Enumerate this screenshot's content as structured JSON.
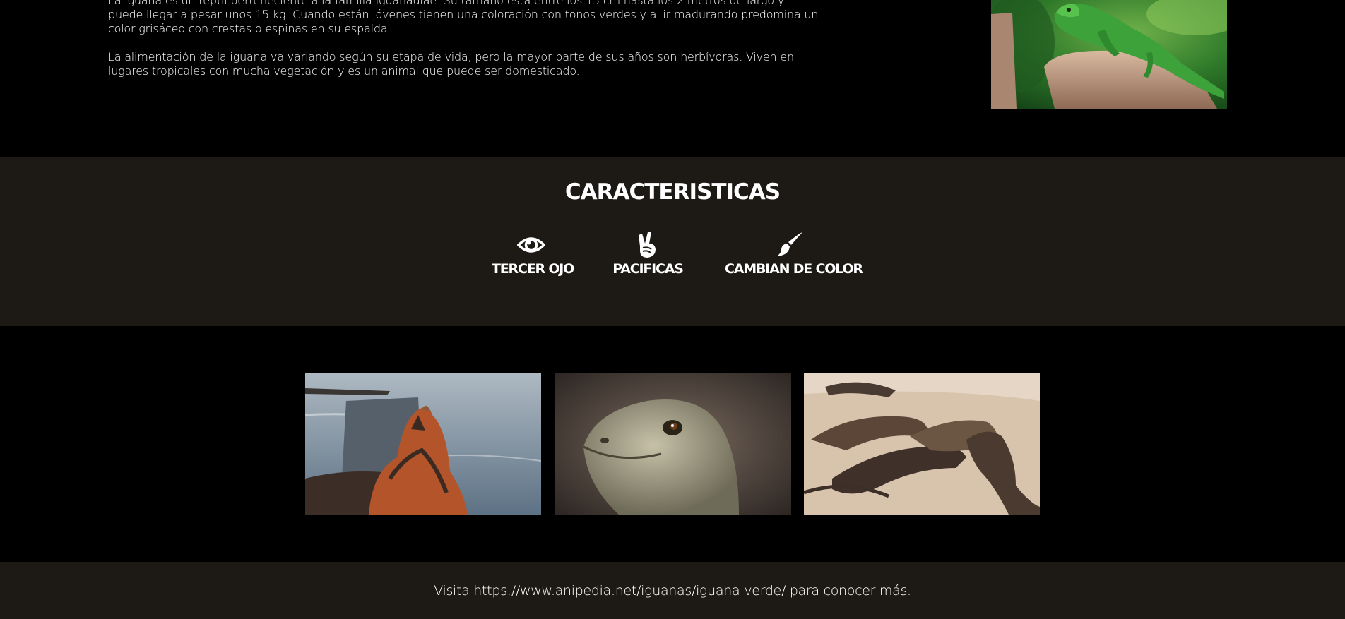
{
  "intro": {
    "paragraph_1": "La iguana es un reptil perteneciente a la familia Iguanadiae. Su tamaño está entre los 15 cm hasta los 2 metros de largo y puede llegar a pesar unos 15 kg. Cuando están jóvenes tienen una coloración con tonos verdes y al ir madurando predomina un color grisáceo con crestas o espinas en su espalda.",
    "paragraph_2": "La alimentación de la iguana va variando según su etapa de vida, pero la mayor parte de sus años son herbívoras. Viven en lugares tropicales con mucha vegetación y es un animal que puede ser domesticado."
  },
  "features": {
    "title": "CARACTERISTICAS",
    "items": [
      {
        "icon": "eye-icon",
        "label": "TERCER OJO"
      },
      {
        "icon": "peace-hand-icon",
        "label": "PACIFICAS"
      },
      {
        "icon": "paintbrush-icon",
        "label": "CAMBIAN DE COLOR"
      }
    ]
  },
  "footer": {
    "prefix": "Visita ",
    "link_text": "https://www.anipedia.net/iguanas/iguana-verde/",
    "suffix": " para conocer más."
  },
  "colors": {
    "page_background": "#000000",
    "band_background": "#1d1914",
    "text": "#ffffff"
  }
}
